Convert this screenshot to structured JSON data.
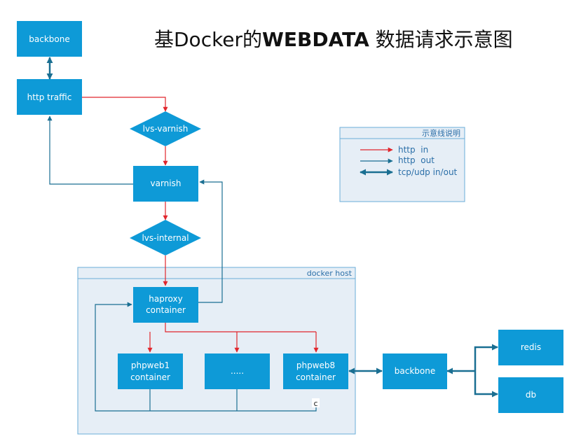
{
  "title_prefix": "基Docker的",
  "title_bold": "WEBDATA",
  "title_suffix": " 数据请求示意图",
  "colors": {
    "node_fill": "#0e9ad7",
    "container_fill": "#e6eef6",
    "container_stroke": "#6aaed8",
    "http_in": "#e1262c",
    "http_out": "#1a6f92",
    "tcp": "#1a6f92",
    "node_text": "#ffffff",
    "label_text": "#2b6fa8"
  },
  "docker_host": {
    "label": "docker host"
  },
  "nodes": {
    "backbone_top": "backbone",
    "http_traffic": "http traffic",
    "lvs_varnish": "lvs-varnish",
    "varnish": "varnish",
    "lvs_internal": "lvs-internal",
    "haproxy_line1": "haproxy",
    "haproxy_line2": "container",
    "phpweb1_line1": "phpweb1",
    "phpweb1_line2": "container",
    "dots": ".....",
    "phpweb8_line1": "phpweb8",
    "phpweb8_line2": "container",
    "backbone_right": "backbone",
    "redis": "redis",
    "db": "db"
  },
  "small_label": "c",
  "legend": {
    "title": "示意线说明",
    "items": [
      {
        "label": "http  in",
        "kind": "http_in"
      },
      {
        "label": "http  out",
        "kind": "http_out"
      },
      {
        "label": "tcp/udp in/out",
        "kind": "tcp"
      }
    ]
  }
}
